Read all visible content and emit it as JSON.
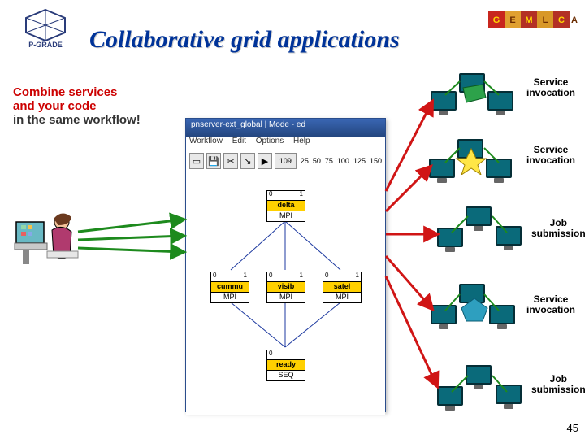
{
  "page": {
    "title": "Collaborative grid applications",
    "number": "45"
  },
  "subtitle": {
    "l1": "Combine services",
    "l2": "and your code",
    "l3": "in the same workflow!"
  },
  "labels": {
    "r1": "Service invocation",
    "r2": "Service invocation",
    "r3": "Job submission",
    "r4": "Service invocation",
    "r5": "Job submission"
  },
  "workflow": {
    "titlebar": "pnserver-ext_global | Mode - ed",
    "menu": [
      "Workflow",
      "Edit",
      "Options",
      "Help"
    ],
    "ticks": [
      "25",
      "50",
      "75",
      "100",
      "125",
      "150"
    ],
    "nodes": {
      "delta": {
        "label": "delta",
        "sys": "MPI"
      },
      "cummu": {
        "label": "cummu",
        "sys": "MPI"
      },
      "visib": {
        "label": "visib",
        "sys": "MPI"
      },
      "satel": {
        "label": "satel",
        "sys": "MPI"
      },
      "ready": {
        "label": "ready",
        "sys": "SEQ"
      }
    }
  }
}
